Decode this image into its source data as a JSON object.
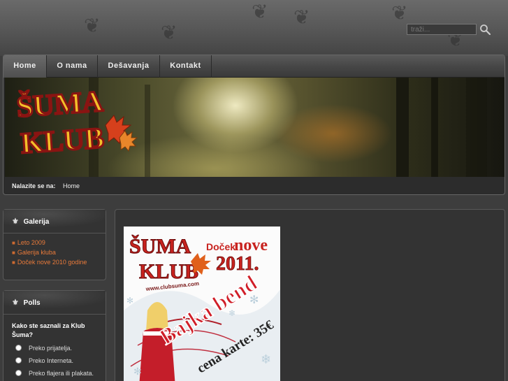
{
  "search": {
    "placeholder": "traži..."
  },
  "nav": {
    "items": [
      "Home",
      "O nama",
      "Dešavanja",
      "Kontakt"
    ]
  },
  "logo": {
    "line1": "ŠUMA",
    "line2": "KLUB"
  },
  "breadcrumb": {
    "label": "Nalazite se na:",
    "current": "Home"
  },
  "gallery": {
    "title": "Galerija",
    "items": [
      "Leto 2009",
      "Galerija kluba",
      "Doček nove 2010 godine"
    ]
  },
  "polls": {
    "title": "Polls",
    "question": "Kako ste saznali za Klub Šuma?",
    "options": [
      "Preko prijatelja.",
      "Preko Interneta.",
      "Preko flajera ili plakata."
    ]
  },
  "poster": {
    "brand_line1": "ŠUMA",
    "brand_line2": "KLUB",
    "headline_prefix": "Doček",
    "headline_word": "nove",
    "year": "2011.",
    "url": "www.clubsuma.com",
    "band": "Bajka bend",
    "price": "cena karte: 35€"
  },
  "colors": {
    "accent": "#e87a3a",
    "logo_red": "#c8231f",
    "logo_yellow": "#f3c02a"
  }
}
